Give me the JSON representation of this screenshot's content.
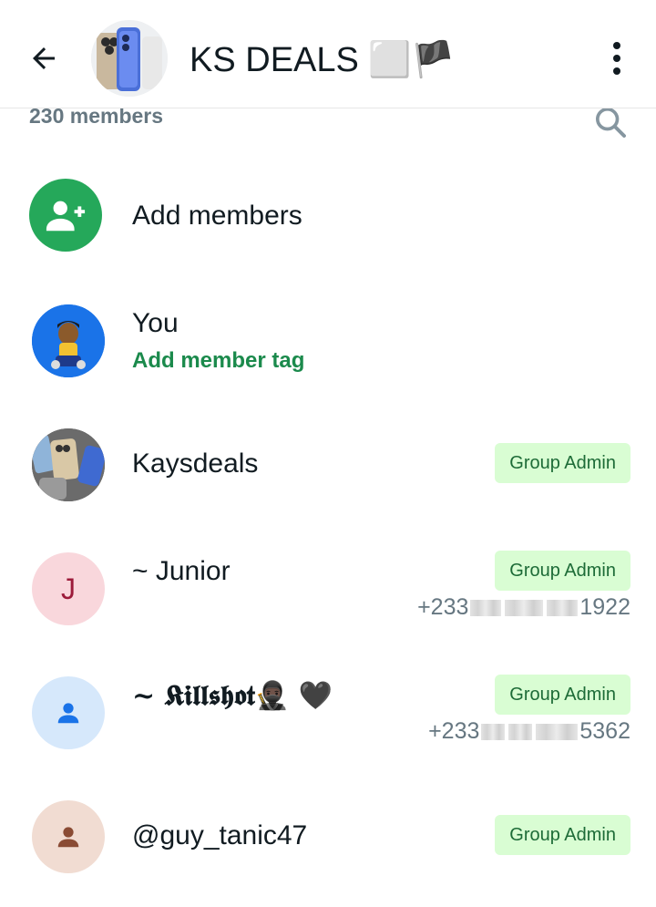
{
  "header": {
    "title": "KS DEALS ⬜🏴",
    "back_icon": "arrow-back-icon",
    "menu_icon": "more-vert-icon"
  },
  "members_bar": {
    "count_text": "230 members",
    "search_icon": "search-icon"
  },
  "add_members": {
    "label": "Add members",
    "icon": "add-person-icon",
    "color": "#25a85a"
  },
  "you": {
    "name": "You",
    "tag_label": "Add member tag",
    "avatar_color": "#1a73e8"
  },
  "members": [
    {
      "name": "Kaysdeals",
      "badge": "Group Admin"
    },
    {
      "name": "~ Junior",
      "initial": "J",
      "badge": "Group Admin",
      "phone_start": "+233",
      "phone_end": "1922",
      "avatar_color": "#f9d7dc",
      "initial_color": "#9c1b3a"
    },
    {
      "name": "~ 𝕶𝖎𝖑𝖑𝖘𝖍𝖔𝖙🥷🏿 🖤",
      "badge": "Group Admin",
      "phone_start": "+233",
      "phone_end": "5362",
      "avatar_color": "#d6e8fb",
      "icon_color": "#1a73e8"
    },
    {
      "name": "@guy_tanic47",
      "badge": "Group Admin",
      "avatar_color": "#f1dcd2",
      "icon_color": "#8a4b34"
    }
  ],
  "accent": "#d9fdd3"
}
